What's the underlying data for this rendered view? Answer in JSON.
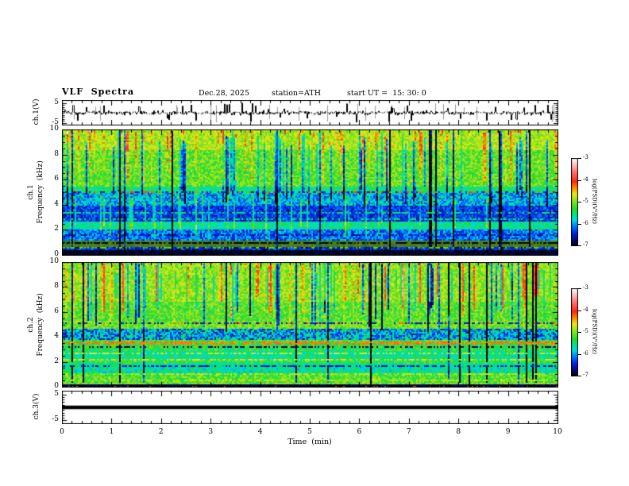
{
  "title": {
    "main": "VLF  Spectra",
    "date": "Dec.28, 2025",
    "station": "station=ATH",
    "start_ut": "start UT =  15: 30: 0"
  },
  "axes": {
    "x_label": "Time  (min)"
  },
  "panels": {
    "wave1": {
      "ylabel": "ch.1(V)"
    },
    "spec1": {
      "ylabel_ch": "ch.1",
      "ylabel_freq": "Frequency  (kHz)"
    },
    "spec2": {
      "ylabel_ch": "ch.2",
      "ylabel_freq": "Frequency  (kHz)"
    },
    "wave3": {
      "ylabel": "ch.3(V)"
    }
  },
  "colorbar_label": "log(PSD)(V²/Hz)",
  "chart_data": {
    "type": "heatmap",
    "title": "VLF Spectra",
    "x": {
      "label": "Time (min)",
      "range": [
        0,
        10
      ],
      "ticks": [
        0,
        1,
        2,
        3,
        4,
        5,
        6,
        7,
        8,
        9,
        10
      ],
      "minor_step": 0.2
    },
    "colorbar": {
      "label": "log(PSD)(V²/Hz)",
      "range": [
        -3,
        -7
      ],
      "ticks": [
        -3,
        -4,
        -5,
        -6,
        -7
      ]
    },
    "palette": [
      [
        -7.0,
        [
          0,
          0,
          0
        ]
      ],
      [
        -6.78,
        [
          8,
          8,
          96
        ]
      ],
      [
        -6.45,
        [
          0,
          32,
          220
        ]
      ],
      [
        -6.12,
        [
          0,
          120,
          255
        ]
      ],
      [
        -5.85,
        [
          0,
          216,
          228
        ]
      ],
      [
        -5.6,
        [
          0,
          228,
          144
        ]
      ],
      [
        -5.3,
        [
          44,
          216,
          44
        ]
      ],
      [
        -4.95,
        [
          140,
          228,
          32
        ]
      ],
      [
        -4.62,
        [
          232,
          232,
          24
        ]
      ],
      [
        -4.38,
        [
          255,
          148,
          0
        ]
      ],
      [
        -4.05,
        [
          255,
          40,
          16
        ]
      ],
      [
        -3.6,
        [
          255,
          120,
          120
        ]
      ],
      [
        -3.25,
        [
          255,
          200,
          200
        ]
      ],
      [
        -3.0,
        [
          255,
          255,
          255
        ]
      ]
    ],
    "seed": 1228,
    "panels": [
      {
        "id": "wave1",
        "kind": "waveform",
        "ylabel": "ch.1(V)",
        "units": "V",
        "ylim": [
          -6.4,
          6.4
        ],
        "yticks": [
          5,
          -5
        ],
        "noise_sigma": 0.5,
        "spike_prob": 0.07,
        "spike_amp": [
          1.8,
          4.4
        ],
        "gray_spikes": 24,
        "gray_amp": [
          2.6,
          5.0
        ],
        "color": "#000000",
        "gray_color": "#999999"
      },
      {
        "id": "spec1",
        "kind": "spectrogram",
        "ylabel": "ch.1 Frequency (kHz)",
        "units": "kHz",
        "ylim": [
          0,
          10
        ],
        "yticks": [
          0,
          2,
          4,
          6,
          8,
          10
        ],
        "bands": [
          [
            8.4,
            10.01,
            -4.85,
            0.3
          ],
          [
            5.5,
            8.4,
            -5.1,
            0.35
          ],
          [
            5.0,
            5.5,
            -5.5,
            0.35
          ],
          [
            4.0,
            5.0,
            -5.95,
            0.45
          ],
          [
            2.65,
            4.0,
            -6.35,
            0.3
          ],
          [
            2.1,
            2.65,
            -5.6,
            0.3
          ],
          [
            1.25,
            2.1,
            -6.15,
            0.35
          ],
          [
            0.75,
            1.25,
            -4.95,
            0.3,
            0.55
          ],
          [
            0.4,
            0.75,
            -6.5,
            0.4
          ],
          [
            0.0,
            0.4,
            -6.9,
            0.12
          ]
        ],
        "hlines": [
          [
            5.08,
            -4.15,
            0.3
          ],
          [
            4.98,
            -6.5,
            0.35
          ],
          [
            3.35,
            -5.5,
            0.5
          ],
          [
            2.95,
            -5.55,
            0.45
          ],
          [
            1.6,
            -6.6,
            0.5
          ],
          [
            1.0,
            -6.85,
            0.7
          ],
          [
            0.62,
            -5.2,
            0.35
          ]
        ],
        "streaks": [
          {
            "p": 0.16,
            "dv": -1.0,
            "top": [
              8.5,
              10
            ],
            "bot": [
              3.8,
              5.5
            ]
          },
          {
            "p": 0.14,
            "dv": 0.5,
            "top": [
              9.7,
              10
            ],
            "bot": [
              5.5,
              8.0
            ]
          },
          {
            "p": 0.12,
            "dv": 0.55,
            "top": [
              4.2,
              5.0
            ],
            "bot": [
              1.3,
              2.6
            ]
          },
          {
            "p": 0.05,
            "dv": -1.6,
            "top": [
              9.9,
              10
            ],
            "bot": [
              0.3,
              0.6
            ]
          },
          {
            "p": 0.06,
            "dv": 0.9,
            "top": [
              10,
              10
            ],
            "bot": [
              9.6,
              9.85
            ]
          }
        ]
      },
      {
        "id": "spec2",
        "kind": "spectrogram",
        "ylabel": "ch.2 Frequency (kHz)",
        "units": "kHz",
        "ylim": [
          0,
          10
        ],
        "yticks": [
          0,
          2,
          4,
          6,
          8,
          10
        ],
        "bands": [
          [
            6.8,
            10.01,
            -4.95,
            0.3
          ],
          [
            5.3,
            6.8,
            -5.15,
            0.35
          ],
          [
            4.65,
            5.3,
            -5.05,
            0.3
          ],
          [
            3.85,
            4.65,
            -6.0,
            0.6
          ],
          [
            3.6,
            3.85,
            -5.2,
            0.3
          ],
          [
            2.85,
            3.6,
            -5.35,
            0.35
          ],
          [
            2.3,
            2.85,
            -5.6,
            0.3
          ],
          [
            1.85,
            2.3,
            -5.3,
            0.35
          ],
          [
            1.2,
            1.85,
            -5.65,
            0.35
          ],
          [
            0.25,
            1.2,
            -5.15,
            0.35
          ],
          [
            0.0,
            0.25,
            -6.85,
            0.15
          ]
        ],
        "hlines": [
          [
            5.1,
            -6.5,
            0.45
          ],
          [
            5.18,
            -4.2,
            0.12
          ],
          [
            3.5,
            -4.3,
            0.75,
            0.13
          ],
          [
            3.2,
            -6.8,
            0.45
          ],
          [
            2.7,
            -4.7,
            0.45
          ],
          [
            2.2,
            -4.6,
            0.5
          ],
          [
            1.9,
            -5.6,
            0.55
          ],
          [
            1.75,
            -6.6,
            0.6
          ],
          [
            1.12,
            -4.8,
            0.5
          ],
          [
            0.6,
            -4.75,
            0.45
          ],
          [
            0.35,
            -4.9,
            0.4
          ],
          [
            0.1,
            -4.2,
            0.12
          ]
        ],
        "streaks": [
          {
            "p": 0.1,
            "dv": 0.8,
            "top": [
              9.7,
              10
            ],
            "bot": [
              5.3,
              7.5
            ]
          },
          {
            "p": 0.12,
            "dv": -1.2,
            "top": [
              9.8,
              10
            ],
            "bot": [
              4.3,
              6.5
            ]
          },
          {
            "p": 0.1,
            "dv": -0.55,
            "top": [
              9.0,
              10
            ],
            "bot": [
              6.0,
              8.0
            ]
          },
          {
            "p": 0.045,
            "dv": -1.8,
            "top": [
              10,
              10
            ],
            "bot": [
              0.2,
              0.5
            ]
          },
          {
            "p": 0.1,
            "dv": 0.35,
            "top": [
              9.5,
              10
            ],
            "bot": [
              4.5,
              6.0
            ]
          }
        ]
      },
      {
        "id": "wave3",
        "kind": "flatline",
        "ylabel": "ch.3(V)",
        "units": "V",
        "ylim": [
          -6.4,
          6.4
        ],
        "yticks": [
          5,
          -5
        ],
        "value": 0,
        "thickness": 4.5,
        "color": "#000000"
      }
    ]
  }
}
